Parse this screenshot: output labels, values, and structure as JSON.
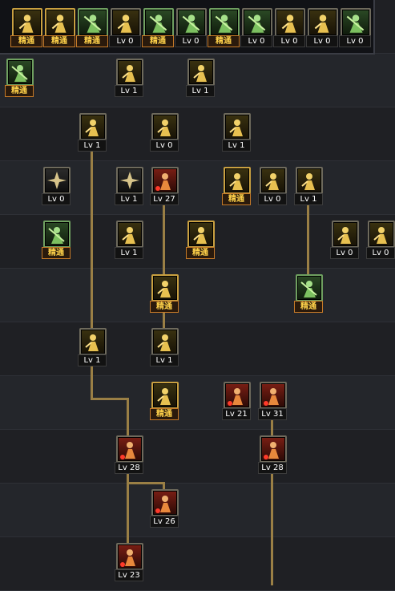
{
  "toolbar": {
    "items": [
      {
        "icon": "crouch-icon",
        "level": "精通",
        "master": true,
        "tone": "yellow"
      },
      {
        "icon": "lift-icon",
        "level": "精通",
        "master": true,
        "tone": "yellow"
      },
      {
        "icon": "run-green-icon",
        "level": "精通",
        "master": true,
        "tone": "green"
      },
      {
        "icon": "wing-icon",
        "level": "Lv 0",
        "master": false,
        "tone": "yellow"
      },
      {
        "icon": "target-icon",
        "level": "精通",
        "master": true,
        "tone": "green"
      },
      {
        "icon": "target-small-icon",
        "level": "Lv 0",
        "master": false,
        "tone": "green"
      },
      {
        "icon": "shout-icon",
        "level": "精通",
        "master": true,
        "tone": "green"
      },
      {
        "icon": "head-icon",
        "level": "Lv 0",
        "master": false,
        "tone": "green"
      },
      {
        "icon": "eye-icon",
        "level": "Lv 0",
        "master": false,
        "tone": "yellow"
      },
      {
        "icon": "power-icon",
        "level": "Lv 0",
        "master": false,
        "tone": "yellow"
      },
      {
        "icon": "strike-green-icon",
        "level": "Lv 0",
        "master": false,
        "tone": "green"
      }
    ]
  },
  "skills": [
    {
      "icon": "shield-green-icon",
      "level": "精通",
      "master": true,
      "tone": "green"
    },
    {
      "icon": "slash-icon",
      "level": "Lv 1",
      "master": false,
      "tone": "yellow"
    },
    {
      "icon": "dash-icon",
      "level": "Lv 1",
      "master": false,
      "tone": "yellow"
    },
    {
      "icon": "kick-icon",
      "level": "Lv 1",
      "master": false,
      "tone": "yellow"
    },
    {
      "icon": "body-icon",
      "level": "Lv 0",
      "master": false,
      "tone": "yellow"
    },
    {
      "icon": "burst-icon",
      "level": "Lv 1",
      "master": false,
      "tone": "yellow"
    },
    {
      "icon": "spark-icon",
      "level": "Lv 0",
      "master": false,
      "tone": "dark"
    },
    {
      "icon": "claw-icon",
      "level": "Lv 1",
      "master": false,
      "tone": "dark"
    },
    {
      "icon": "muscle-icon",
      "level": "Lv 27",
      "master": false,
      "tone": "red"
    },
    {
      "icon": "sprint-icon",
      "level": "精通",
      "master": true,
      "tone": "yellow"
    },
    {
      "icon": "climb-icon",
      "level": "Lv 0",
      "master": false,
      "tone": "yellow"
    },
    {
      "icon": "rush-icon",
      "level": "Lv 1",
      "master": false,
      "tone": "yellow"
    },
    {
      "icon": "guard-green-icon",
      "level": "精通",
      "master": true,
      "tone": "green"
    },
    {
      "icon": "punch-icon",
      "level": "Lv 1",
      "master": false,
      "tone": "yellow"
    },
    {
      "icon": "split-icon",
      "level": "精通",
      "master": true,
      "tone": "yellow"
    },
    {
      "icon": "fire-icon",
      "level": "Lv 0",
      "master": false,
      "tone": "yellow"
    },
    {
      "icon": "crescent-icon",
      "level": "Lv 0",
      "master": false,
      "tone": "yellow"
    },
    {
      "icon": "flex-icon",
      "level": "精通",
      "master": true,
      "tone": "yellow"
    },
    {
      "icon": "whirl-green-icon",
      "level": "精通",
      "master": true,
      "tone": "green"
    },
    {
      "icon": "drop-icon",
      "level": "Lv 1",
      "master": false,
      "tone": "yellow"
    },
    {
      "icon": "stance-icon",
      "level": "Lv 1",
      "master": false,
      "tone": "yellow"
    },
    {
      "icon": "blast-icon",
      "level": "精通",
      "master": true,
      "tone": "yellow"
    },
    {
      "icon": "fighter-red-icon",
      "level": "Lv 21",
      "master": false,
      "tone": "red"
    },
    {
      "icon": "flip-red-icon",
      "level": "Lv 31",
      "master": false,
      "tone": "red"
    },
    {
      "icon": "kick-red-icon",
      "level": "Lv 28",
      "master": false,
      "tone": "red"
    },
    {
      "icon": "strike-red-icon",
      "level": "Lv 28",
      "master": false,
      "tone": "red"
    },
    {
      "icon": "zigzag-red-icon",
      "level": "Lv 26",
      "master": false,
      "tone": "red"
    },
    {
      "icon": "fall-red-icon",
      "level": "Lv 23",
      "master": false,
      "tone": "red"
    }
  ]
}
